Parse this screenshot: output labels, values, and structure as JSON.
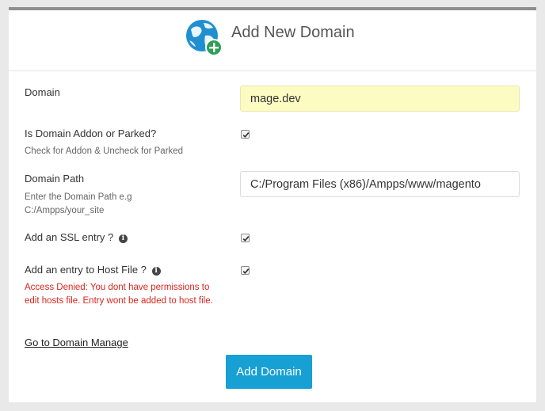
{
  "header": {
    "title": "Add New Domain",
    "logo_icon": "globe-plus-icon"
  },
  "form": {
    "domain": {
      "label": "Domain",
      "value": "mage.dev"
    },
    "addon": {
      "label": "Is Domain Addon or Parked?",
      "hint": "Check for Addon & Uncheck for Parked",
      "checked": true
    },
    "path": {
      "label": "Domain Path",
      "hint": "Enter the Domain Path e.g C:/Ampps/your_site",
      "value": "C:/Program Files (x86)/Ampps/www/magento"
    },
    "ssl": {
      "label": "Add an SSL entry ?",
      "info_icon": "info-icon",
      "checked": true
    },
    "hosts": {
      "label": "Add an entry to Host File ?",
      "info_icon": "info-icon",
      "checked": true,
      "error": "Access Denied: You dont have permissions to edit hosts file. Entry wont be added to host file."
    }
  },
  "links": {
    "manage": "Go to Domain Manage"
  },
  "buttons": {
    "add": "Add Domain"
  },
  "colors": {
    "accent": "#17a0d4",
    "error": "#d9251c",
    "highlight": "#fbfbc2"
  }
}
